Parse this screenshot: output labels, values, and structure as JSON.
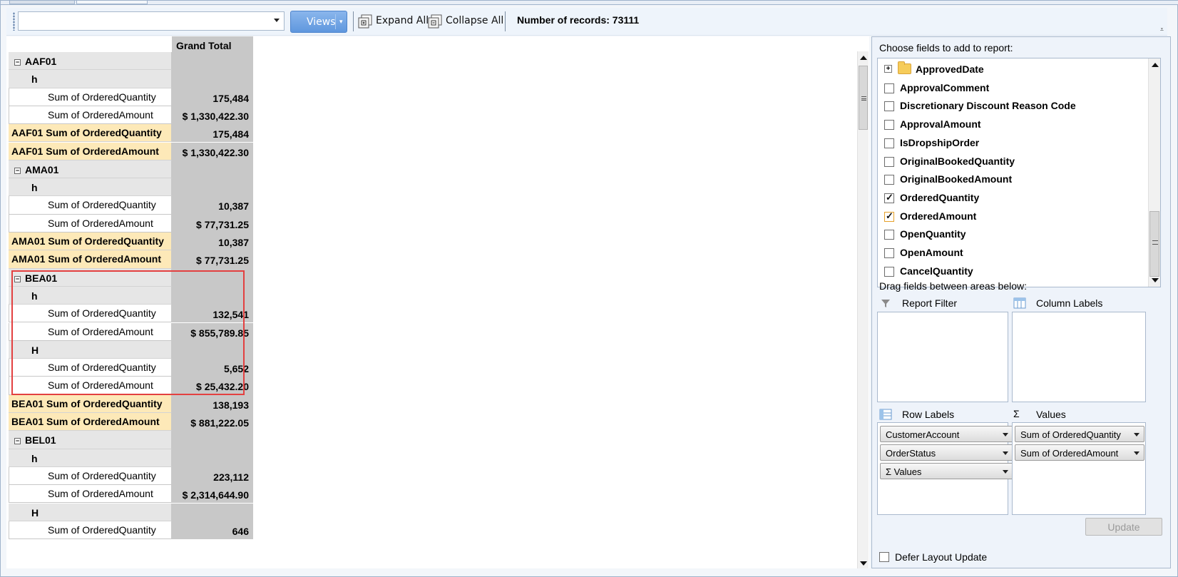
{
  "toolbar": {
    "combo_value": "",
    "views_label": "Views",
    "expand_all_label": "Expand All",
    "collapse_all_label": "Collapse All",
    "records_text": "Number of records: 73111"
  },
  "pivot": {
    "column_header": "Grand Total",
    "rows": [
      {
        "type": "group",
        "label": "AAF01",
        "value": ""
      },
      {
        "type": "status",
        "label": "h",
        "value": ""
      },
      {
        "type": "measure",
        "label": "Sum of OrderedQuantity",
        "value": "175,484"
      },
      {
        "type": "measure",
        "label": "Sum of OrderedAmount",
        "value": "$ 1,330,422.30"
      },
      {
        "type": "total",
        "label": "AAF01 Sum of OrderedQuantity",
        "value": "175,484"
      },
      {
        "type": "total",
        "label": "AAF01 Sum of OrderedAmount",
        "value": "$ 1,330,422.30"
      },
      {
        "type": "group",
        "label": "AMA01",
        "value": ""
      },
      {
        "type": "status",
        "label": "h",
        "value": ""
      },
      {
        "type": "measure",
        "label": "Sum of OrderedQuantity",
        "value": "10,387"
      },
      {
        "type": "measure",
        "label": "Sum of OrderedAmount",
        "value": "$ 77,731.25"
      },
      {
        "type": "total",
        "label": "AMA01 Sum of OrderedQuantity",
        "value": "10,387"
      },
      {
        "type": "total",
        "label": "AMA01 Sum of OrderedAmount",
        "value": "$ 77,731.25"
      },
      {
        "type": "group",
        "label": "BEA01",
        "value": ""
      },
      {
        "type": "status",
        "label": "h",
        "value": ""
      },
      {
        "type": "measure",
        "label": "Sum of OrderedQuantity",
        "value": "132,541"
      },
      {
        "type": "measure",
        "label": "Sum of OrderedAmount",
        "value": "$ 855,789.85"
      },
      {
        "type": "status",
        "label": "H",
        "value": ""
      },
      {
        "type": "measure",
        "label": "Sum of OrderedQuantity",
        "value": "5,652"
      },
      {
        "type": "measure",
        "label": "Sum of OrderedAmount",
        "value": "$ 25,432.20"
      },
      {
        "type": "total",
        "label": "BEA01 Sum of OrderedQuantity",
        "value": "138,193"
      },
      {
        "type": "total",
        "label": "BEA01 Sum of OrderedAmount",
        "value": "$ 881,222.05"
      },
      {
        "type": "group",
        "label": "BEL01",
        "value": ""
      },
      {
        "type": "status",
        "label": "h",
        "value": ""
      },
      {
        "type": "measure",
        "label": "Sum of OrderedQuantity",
        "value": "223,112"
      },
      {
        "type": "measure",
        "label": "Sum of OrderedAmount",
        "value": "$ 2,314,644.90"
      },
      {
        "type": "status",
        "label": "H",
        "value": ""
      },
      {
        "type": "measure",
        "label": "Sum of OrderedQuantity",
        "value": "646"
      }
    ]
  },
  "field_list": {
    "title": "Choose fields to add to report:",
    "fields": [
      {
        "label": "ApprovedDate",
        "kind": "group",
        "checked": false
      },
      {
        "label": "ApprovalComment",
        "kind": "field",
        "checked": false
      },
      {
        "label": "Discretionary Discount Reason Code",
        "kind": "field",
        "checked": false
      },
      {
        "label": "ApprovalAmount",
        "kind": "field",
        "checked": false
      },
      {
        "label": "IsDropshipOrder",
        "kind": "field",
        "checked": false
      },
      {
        "label": "OriginalBookedQuantity",
        "kind": "field",
        "checked": false
      },
      {
        "label": "OriginalBookedAmount",
        "kind": "field",
        "checked": false
      },
      {
        "label": "OrderedQuantity",
        "kind": "field",
        "checked": true
      },
      {
        "label": "OrderedAmount",
        "kind": "field",
        "checked": true
      },
      {
        "label": "OpenQuantity",
        "kind": "field",
        "checked": false
      },
      {
        "label": "OpenAmount",
        "kind": "field",
        "checked": false
      },
      {
        "label": "CancelQuantity",
        "kind": "field",
        "checked": false
      }
    ],
    "drag_title": "Drag fields between areas below:",
    "report_filter_label": "Report Filter",
    "column_labels_label": "Column Labels",
    "row_labels_label": "Row Labels",
    "values_label": "Values",
    "row_label_items": [
      "CustomerAccount",
      "OrderStatus",
      "Σ  Values"
    ],
    "value_items": [
      "Sum of OrderedQuantity",
      "Sum of OrderedAmount"
    ],
    "defer_label": "Defer Layout Update",
    "update_label": "Update"
  },
  "colors": {
    "accent": "#5f97de",
    "subtotal_row": "#fde9b8",
    "value_column": "#c8c8c8",
    "highlight": "#e34040"
  }
}
